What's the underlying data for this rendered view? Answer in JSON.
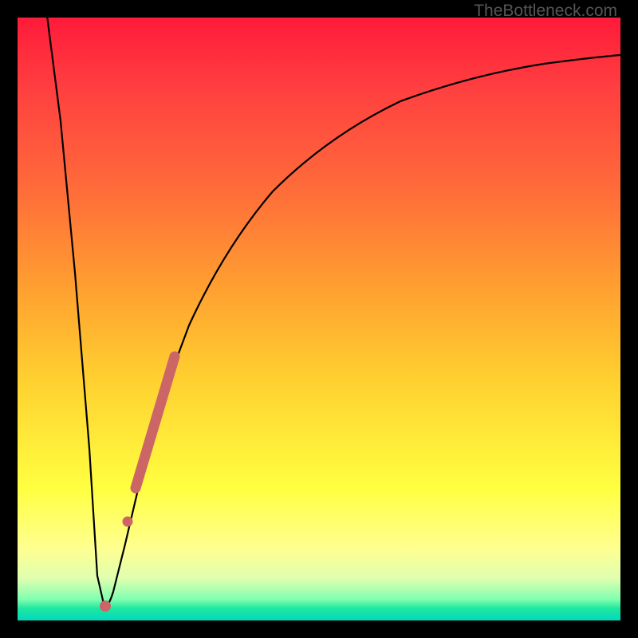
{
  "watermark": "TheBottleneck.com",
  "colors": {
    "frame": "#000000",
    "curve": "#000000",
    "marker": "#cc6666",
    "gradient_top": "#ff1a3a",
    "gradient_bottom": "#00d8c0"
  },
  "chart_data": {
    "type": "line",
    "title": "",
    "xlabel": "",
    "ylabel": "",
    "xlim": [
      0,
      100
    ],
    "ylim": [
      0,
      100
    ],
    "series": [
      {
        "name": "bottleneck-curve",
        "x": [
          5,
          7,
          9,
          11,
          13,
          15,
          17,
          20,
          23,
          27,
          32,
          38,
          45,
          55,
          65,
          75,
          85,
          95,
          100
        ],
        "y": [
          100,
          80,
          55,
          25,
          3,
          3,
          12,
          24,
          35,
          46,
          56,
          65,
          73,
          80,
          85,
          88,
          90,
          92,
          92.5
        ]
      }
    ],
    "markers": [
      {
        "name": "thick-segment",
        "x": [
          19.5,
          26
        ],
        "y": [
          22,
          44
        ],
        "width": 10
      },
      {
        "name": "dot-mid",
        "x": 18,
        "y": 15,
        "r": 5
      },
      {
        "name": "dot-min",
        "x": 14,
        "y": 2.5,
        "r": 5
      }
    ],
    "notes": "Axes unlabeled; values are relative percentages estimated from pixel position. Curve is a steep V dipping near x≈14 then asymptoting toward ~92% on the right."
  }
}
